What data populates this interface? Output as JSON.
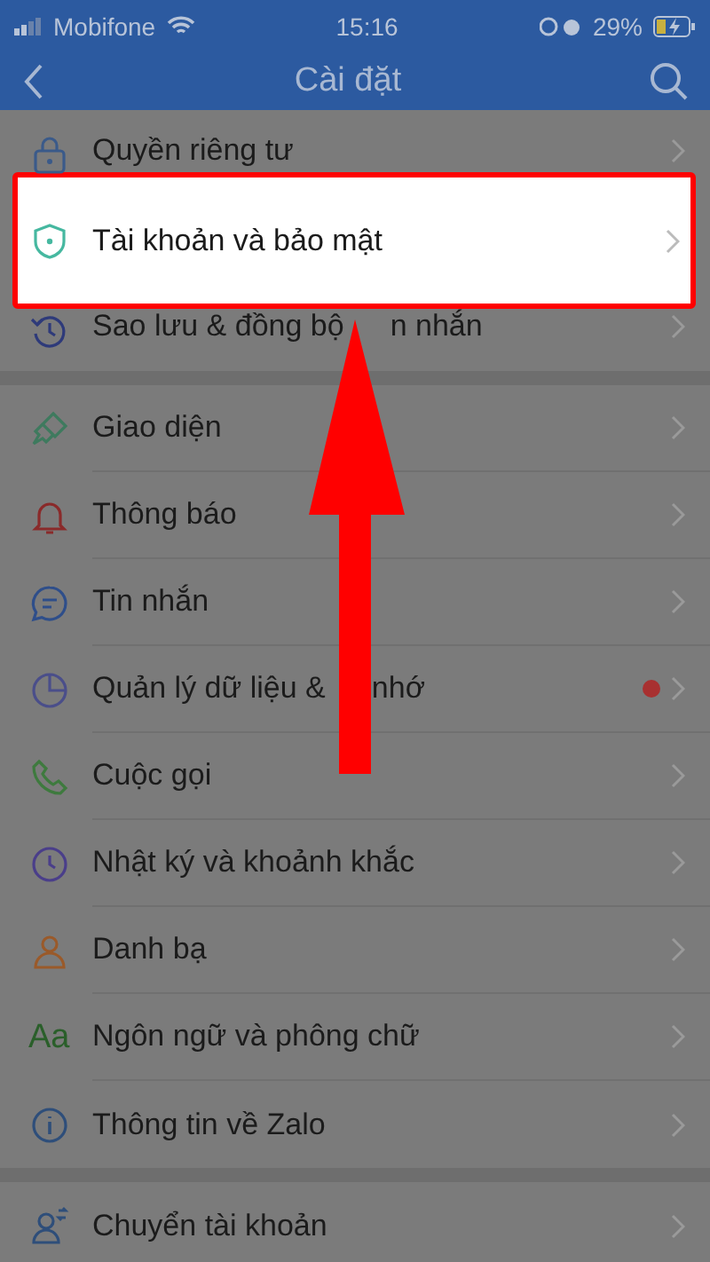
{
  "status_bar": {
    "carrier": "Mobifone",
    "time": "15:16",
    "battery": "29%"
  },
  "nav": {
    "title": "Cài đặt"
  },
  "sections": [
    {
      "items": [
        {
          "label_parts": [
            "Quyền riêng tư"
          ],
          "highlighted": false,
          "dot": false
        },
        {
          "label_parts": [
            "Tài khoản và bảo mật"
          ],
          "highlighted": true,
          "dot": false
        },
        {
          "label_parts": [
            "Sao lưu & đồng bộ",
            "n nhắn"
          ],
          "highlighted": false,
          "dot": false
        }
      ]
    },
    {
      "items": [
        {
          "label_parts": [
            "Giao diện"
          ],
          "highlighted": false,
          "dot": false
        },
        {
          "label_parts": [
            "Thông báo"
          ],
          "highlighted": false,
          "dot": false
        },
        {
          "label_parts": [
            "Tin nhắn"
          ],
          "highlighted": false,
          "dot": false
        },
        {
          "label_parts": [
            "Quản lý dữ liệu &",
            "nhớ"
          ],
          "highlighted": false,
          "dot": true
        },
        {
          "label_parts": [
            "Cuộc gọi"
          ],
          "highlighted": false,
          "dot": false
        },
        {
          "label_parts": [
            "Nhật ký và khoảnh khắc"
          ],
          "highlighted": false,
          "dot": false
        },
        {
          "label_parts": [
            "Danh bạ"
          ],
          "highlighted": false,
          "dot": false
        },
        {
          "label_parts": [
            "Ngôn ngữ và phông chữ"
          ],
          "highlighted": false,
          "dot": false,
          "icon_text": "Aa"
        },
        {
          "label_parts": [
            "Thông tin về Zalo"
          ],
          "highlighted": false,
          "dot": false
        }
      ]
    },
    {
      "items": [
        {
          "label_parts": [
            "Chuyển tài khoản"
          ],
          "highlighted": false,
          "dot": false
        }
      ]
    }
  ]
}
